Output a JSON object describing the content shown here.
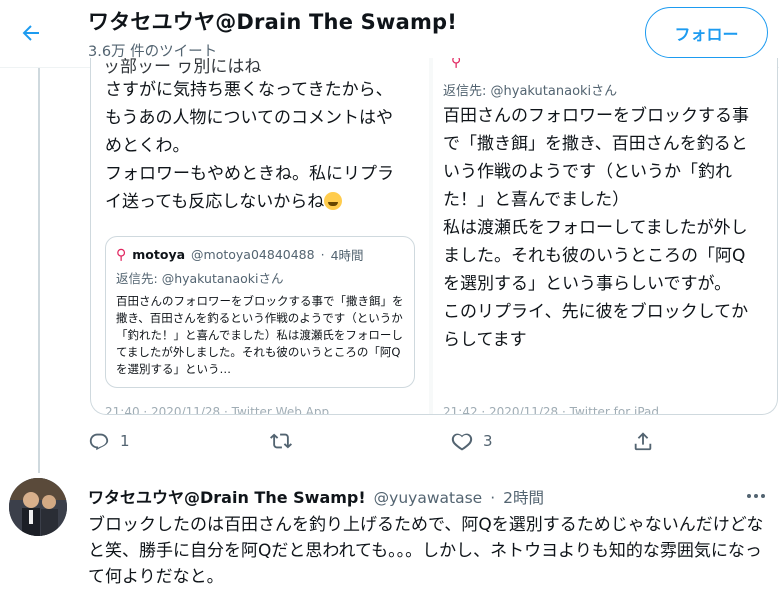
{
  "header": {
    "title": "ワタセユウヤ@Drain The Swamp!",
    "subtitle": "3.6万 件のツイート",
    "follow_label": "フォロー"
  },
  "embed": {
    "left_cut_text": "ッ部ッー ヮ別にはね",
    "left_text": "さすがに気持ち悪くなってきたから、もうあの人物についてのコメントはやめとくわ。\nフォロワーもやめときね。私にリプライ送っても反応しないからね",
    "quote": {
      "name": "motoya",
      "handle": "@motoya04840488",
      "time": "4時間",
      "reply_prefix": "返信先:",
      "reply_handle": "@hyakutanaokiさん",
      "body": "百田さんのフォロワーをブロックする事で「撒き餌」を撒き、百田さんを釣るという作戦のようです（というか「釣れた！」と喜んでました）私は渡瀬氏をフォローしてましたが外しました。それも彼のいうところの「阿Qを選別する」という…"
    },
    "right_reply_prefix": "返信先:",
    "right_reply_handle": "@hyakutanaokiさん",
    "right_text": "百田さんのフォロワーをブロックする事で「撒き餌」を撒き、百田さんを釣るという作戦のようです（というか「釣れた！」と喜んでました）\n私は渡瀬氏をフォローしてましたが外しました。それも彼のいうところの「阿Qを選別する」という事らしいですが。\nこのリプライ、先に彼をブロックしてからしてます",
    "left_footer": "21:40 · 2020/11/28 · Twitter Web App",
    "right_footer": "21:42 · 2020/11/28 · Twitter for iPad"
  },
  "actions": {
    "reply_count": "1",
    "retweet_count": "",
    "like_count": "3",
    "share_count": ""
  },
  "reply_tweet": {
    "name": "ワタセユウヤ@Drain The Swamp!",
    "handle": "@yuyawatase",
    "separator": "·",
    "time": "2時間",
    "text": "ブロックしたのは百田さんを釣り上げるためで、阿Qを選別するためじゃないんだけどなと笑、勝手に自分を阿Qだと思われても。。。しかし、ネトウヨよりも知的な雰囲気になって何よりだなと。"
  },
  "colors": {
    "accent": "#1d9bf0",
    "secondary_text": "#536471",
    "border": "#cfd9de"
  },
  "icons": [
    "back-arrow-icon",
    "reply-icon",
    "retweet-icon",
    "like-icon",
    "share-icon",
    "more-icon"
  ]
}
